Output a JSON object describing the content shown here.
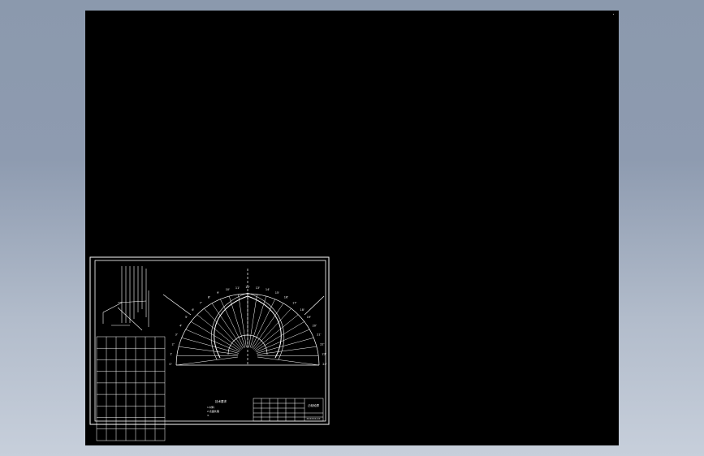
{
  "app": {
    "viewport_label": "CAD drawing viewport (black model space)",
    "background_gradient": [
      "#8b99ad",
      "#c7cfdb"
    ],
    "canvas_color": "#000000",
    "line_color": "#ffffff"
  },
  "drawing": {
    "frame": "outer and inner drawing border",
    "notes_title": "技术要求",
    "title_block_name": "凸轮轮廓",
    "title_block_code": "XXXXXX-XX",
    "notes_lines": [
      "1.材料",
      "2.表面处理",
      "3."
    ],
    "angle_labels_left": [
      "0'",
      "1'",
      "2'",
      "3'",
      "4'",
      "5'",
      "6'",
      "7'",
      "8'",
      "9'",
      "10'",
      "11'",
      "12'"
    ],
    "angle_labels_right": [
      "13'",
      "14'",
      "15'",
      "16'",
      "17'",
      "18'",
      "19'",
      "20'",
      "21'",
      "22'",
      "23'",
      "24'"
    ],
    "table_rows": 9,
    "table_cols": 7
  }
}
